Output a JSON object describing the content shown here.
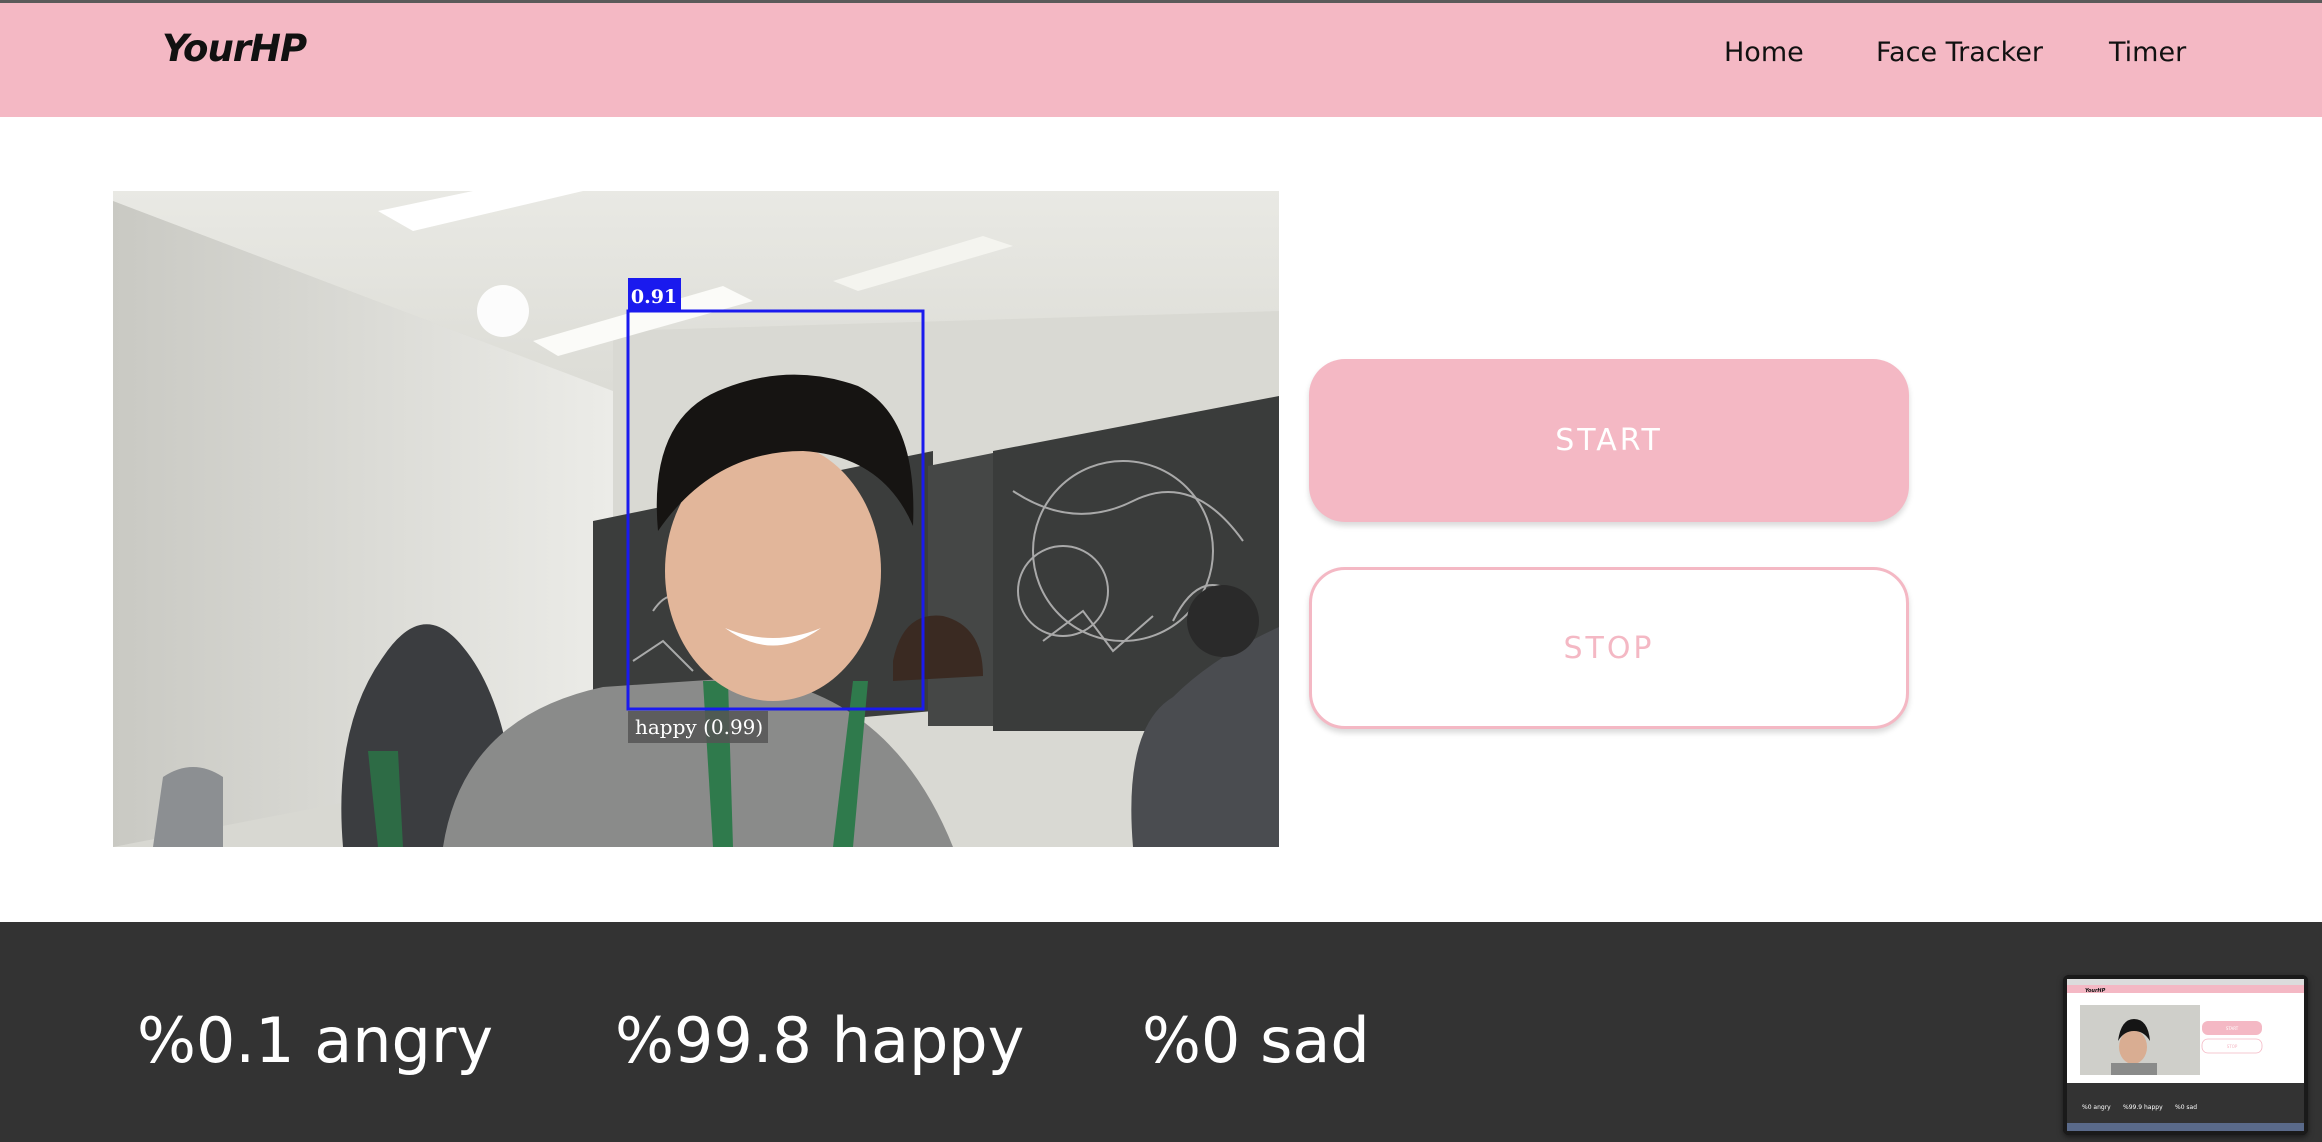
{
  "navbar": {
    "brand": "YourHP",
    "links": [
      "Home",
      "Face Tracker",
      "Timer"
    ]
  },
  "video": {
    "detection_score": "0.91",
    "expression_label": "happy (0.99)"
  },
  "controls": {
    "start_label": "START",
    "stop_label": "STOP"
  },
  "emotions": [
    {
      "label": "%0.1 angry"
    },
    {
      "label": "%99.8 happy"
    },
    {
      "label": "%0 sad"
    }
  ],
  "colors": {
    "accent_pink": "#f4b8c4",
    "footer_bg": "#333333",
    "detection_box": "#1a1aee"
  },
  "thumbnail": {
    "title": "YourHP",
    "start_label": "START",
    "stop_label": "STOP",
    "emotions": [
      "%0 angry",
      "%99.9 happy",
      "%0 sad"
    ]
  }
}
